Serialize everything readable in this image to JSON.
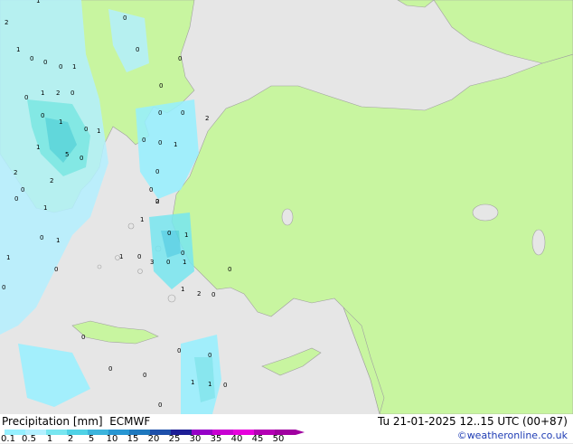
{
  "map": {
    "colors": {
      "sea": "#e6e6e6",
      "land": "#c8f5a0",
      "coast": "#a0a0a0"
    },
    "point_values": [
      "1",
      "2",
      "0",
      "0",
      "1",
      "0",
      "0",
      "0",
      "1",
      "0",
      "0",
      "2",
      "0",
      "1",
      "0",
      "0",
      "1",
      "0",
      "1",
      "0",
      "0",
      "2",
      "0",
      "0",
      "1",
      "1",
      "5",
      "0",
      "2",
      "0",
      "2",
      "0",
      "0",
      "1",
      "2",
      "0",
      "1",
      "0",
      "1",
      "0",
      "1",
      "0",
      "1",
      "0",
      "3",
      "0",
      "1",
      "1",
      "0",
      "0",
      "1",
      "2",
      "0",
      "0",
      "0",
      "0",
      "0",
      "0",
      "1",
      "1",
      "0",
      "0",
      "0",
      "0"
    ]
  },
  "legend": {
    "title": "Precipitation [mm]",
    "model": "ECMWF",
    "datetime": "Tu 21-01-2025 12..15 UTC (00+87)",
    "credit": "©weatheronline.co.uk",
    "ticks": [
      "0.1",
      "0.5",
      "1",
      "2",
      "5",
      "10",
      "15",
      "20",
      "25",
      "30",
      "35",
      "40",
      "45",
      "50"
    ],
    "colors": [
      "#96f0ff",
      "#b4f0ff",
      "#78e6f0",
      "#50d2e6",
      "#3cb4dc",
      "#2896d2",
      "#1e78be",
      "#1e50aa",
      "#1e1e96",
      "#9600c8",
      "#c800d2",
      "#e600dc",
      "#b400b4",
      "#a000a0"
    ]
  }
}
